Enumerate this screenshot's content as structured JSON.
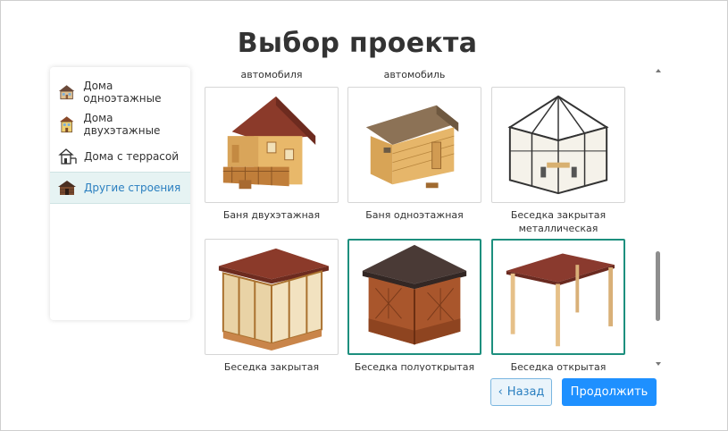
{
  "page": {
    "title": "Выбор проекта"
  },
  "sidebar": {
    "items": [
      {
        "label": "Дома одноэтажные",
        "icon": "one-story-house-icon",
        "active": false
      },
      {
        "label": "Дома двухэтажные",
        "icon": "two-story-house-icon",
        "active": false
      },
      {
        "label": "Дома с террасой",
        "icon": "terrace-house-icon",
        "active": false
      },
      {
        "label": "Другие строения",
        "icon": "other-building-icon",
        "active": true
      }
    ]
  },
  "grid": {
    "top_captions": [
      "автомобиля",
      "автомобиль"
    ],
    "cards": [
      {
        "label": "Баня двухэтажная",
        "selected": false
      },
      {
        "label": "Баня одноэтажная",
        "selected": false
      },
      {
        "label": "Беседка закрытая металлическая",
        "selected": false
      },
      {
        "label": "Беседка закрытая",
        "selected": false
      },
      {
        "label": "Беседка полуоткрытая",
        "selected": true
      },
      {
        "label": "Беседка открытая",
        "selected": true
      }
    ]
  },
  "buttons": {
    "back": "Назад",
    "next": "Продолжить"
  },
  "colors": {
    "accent": "#1e90ff",
    "selected_border": "#1d8f7e",
    "active_bg": "#e6f3f3",
    "active_text": "#2a7fc0"
  }
}
